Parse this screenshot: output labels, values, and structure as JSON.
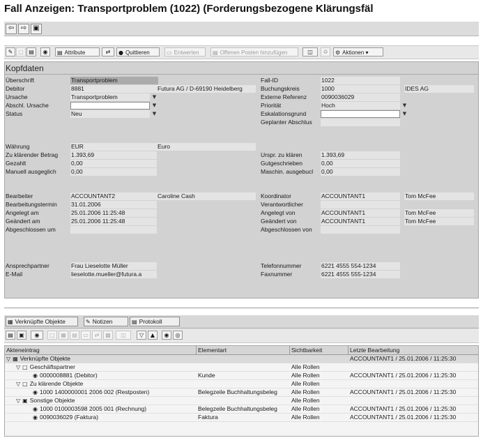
{
  "window": {
    "title": "Fall Anzeigen: Transportproblem (1022) (Forderungsbezogene Klärungsfäl"
  },
  "nav": {
    "back_icon": "arrow-left-icon",
    "forward_icon": "arrow-right-icon",
    "window_icon": "window-icon"
  },
  "toolbar": {
    "attribute": "Attribute",
    "quittieren": "Quittieren",
    "entwerten": "Entwerten",
    "offene_posten": "Offenen Posten hinzufügen",
    "aktionen": "Aktionen"
  },
  "kopfdaten": {
    "title": "Kopfdaten",
    "ueberschrift": {
      "label": "Überschrift",
      "value": "Transportproblem"
    },
    "debitor": {
      "label": "Debitor",
      "value": "8881",
      "desc": "Futura AG / D-69190 Heidelberg"
    },
    "ursache": {
      "label": "Ursache",
      "value": "Transportproblem"
    },
    "abschl_ursache": {
      "label": "Abschl. Ursache",
      "value": ""
    },
    "status": {
      "label": "Status",
      "value": "Neu"
    },
    "fall_id": {
      "label": "Fall-ID",
      "value": "1022"
    },
    "buchungskreis": {
      "label": "Buchungskreis",
      "value": "1000",
      "desc": "IDES AG"
    },
    "ext_referenz": {
      "label": "Externe Referenz",
      "value": "0090036029"
    },
    "prioritaet": {
      "label": "Priorität",
      "value": "Hoch"
    },
    "eskalationsgrund": {
      "label": "Eskalationsgrund",
      "value": ""
    },
    "geplanter_abschluss": {
      "label": "Geplanter Abschlus",
      "value": ""
    },
    "waehrung": {
      "label": "Währung",
      "value": "EUR",
      "desc": "Euro"
    },
    "zu_klaerender_betrag": {
      "label": "Zu klärender Betrag",
      "value": "1.393,69"
    },
    "gezahlt": {
      "label": "Gezahlt",
      "value": "0,00"
    },
    "manuell_ausgeglichen": {
      "label": "Manuell ausgeglich",
      "value": "0,00"
    },
    "urspr_zu_klaeren": {
      "label": "Urspr. zu klären",
      "value": "1.393,69"
    },
    "gutgeschrieben": {
      "label": "Gutgeschrieben",
      "value": "0,00"
    },
    "maschin_ausgebucht": {
      "label": "Maschin. ausgebucl",
      "value": "0,00"
    },
    "bearbeiter": {
      "label": "Bearbeiter",
      "value": "ACCOUNTANT2",
      "desc": "Caroline Cash"
    },
    "bearbeitungstermin": {
      "label": "Bearbeitungstermin",
      "value": "31.01.2006"
    },
    "angelegt_am": {
      "label": "Angelegt am",
      "value": "25.01.2006 11:25:48"
    },
    "geaendert_am": {
      "label": "Geändert am",
      "value": "25.01.2006 11:25:48"
    },
    "abgeschlossen_um": {
      "label": "Abgeschlossen um",
      "value": ""
    },
    "koordinator": {
      "label": "Koordinator",
      "value": "ACCOUNTANT1",
      "desc": "Tom McFee"
    },
    "verantwortlicher": {
      "label": "Verantwortlicher",
      "value": ""
    },
    "angelegt_von": {
      "label": "Angelegt von",
      "value": "ACCOUNTANT1",
      "desc": "Tom McFee"
    },
    "geaendert_von": {
      "label": "Geändert von",
      "value": "ACCOUNTANT1",
      "desc": "Tom McFee"
    },
    "abgeschlossen_von": {
      "label": "Abgeschlossen von",
      "value": ""
    },
    "ansprechpartner": {
      "label": "Ansprechpartner",
      "value": "Frau Lieselotte Müller"
    },
    "email": {
      "label": "E-Mail",
      "value": "lieselotte.mueller@futura.a"
    },
    "telefon": {
      "label": "Telefonnummer",
      "value": "6221 4555 554-1234"
    },
    "fax": {
      "label": "Faxnummer",
      "value": "6221 4555 555-1234"
    }
  },
  "tabs": [
    {
      "label": "Verknüpfte Objekte",
      "icon": "linked-objects-icon"
    },
    {
      "label": "Notizen",
      "icon": "notes-icon"
    },
    {
      "label": "Protokoll",
      "icon": "log-icon"
    }
  ],
  "grid": {
    "columns": [
      "Akteneintrag",
      "Elementart",
      "Sichtbarkeit",
      "Letzte Bearbeitung"
    ],
    "rows": [
      {
        "entry": "Verknüpfte Objekte",
        "type": "",
        "vis": "",
        "last": "ACCOUNTANT1 / 25.01.2006 / 11:25:30"
      },
      {
        "entry": "Geschäftspartner",
        "type": "",
        "vis": "Alle Rollen",
        "last": ""
      },
      {
        "entry": "0000008881 (Debitor)",
        "type": "Kunde",
        "vis": "Alle Rollen",
        "last": "ACCOUNTANT1 / 25.01.2006 / 11:25:30"
      },
      {
        "entry": "Zu klärende Objekte",
        "type": "",
        "vis": "Alle Rollen",
        "last": ""
      },
      {
        "entry": "1000 1400000001 2006 002 (Restposten)",
        "type": "Belegzeile Buchhaltungsbeleg",
        "vis": "Alle Rollen",
        "last": "ACCOUNTANT1 / 25.01.2006 / 11:25:30"
      },
      {
        "entry": "Sonstige Objekte",
        "type": "",
        "vis": "Alle Rollen",
        "last": ""
      },
      {
        "entry": "1000 0100003598 2005 001 (Rechnung)",
        "type": "Belegzeile Buchhaltungsbeleg",
        "vis": "Alle Rollen",
        "last": "ACCOUNTANT1 / 25.01.2006 / 11:25:30"
      },
      {
        "entry": "0090036029 (Faktura)",
        "type": "Faktura",
        "vis": "Alle Rollen",
        "last": "ACCOUNTANT1 / 25.01.2006 / 11:25:30"
      }
    ]
  }
}
